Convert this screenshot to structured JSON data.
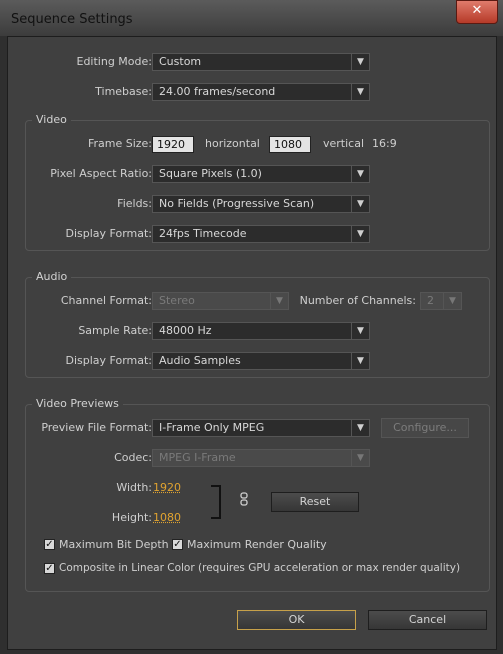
{
  "window": {
    "title": "Sequence Settings",
    "close_glyph": "✕"
  },
  "general": {
    "editing_mode_label": "Editing Mode:",
    "editing_mode_value": "Custom",
    "timebase_label": "Timebase:",
    "timebase_value": "24.00 frames/second"
  },
  "video": {
    "group_title": "Video",
    "frame_size_label": "Frame Size:",
    "frame_width": "1920",
    "horizontal_label": "horizontal",
    "frame_height": "1080",
    "vertical_label": "vertical",
    "aspect": "16:9",
    "par_label": "Pixel Aspect Ratio:",
    "par_value": "Square Pixels (1.0)",
    "fields_label": "Fields:",
    "fields_value": "No Fields (Progressive Scan)",
    "display_format_label": "Display Format:",
    "display_format_value": "24fps Timecode"
  },
  "audio": {
    "group_title": "Audio",
    "channel_format_label": "Channel Format:",
    "channel_format_value": "Stereo",
    "num_channels_label": "Number of Channels:",
    "num_channels_value": "2",
    "sample_rate_label": "Sample Rate:",
    "sample_rate_value": "48000 Hz",
    "display_format_label": "Display Format:",
    "display_format_value": "Audio Samples"
  },
  "previews": {
    "group_title": "Video Previews",
    "file_format_label": "Preview File Format:",
    "file_format_value": "I-Frame Only MPEG",
    "configure_label": "Configure...",
    "codec_label": "Codec:",
    "codec_value": "MPEG I-Frame",
    "width_label": "Width:",
    "width_value": "1920",
    "height_label": "Height:",
    "height_value": "1080",
    "reset_label": "Reset",
    "link_icon": "link-icon"
  },
  "options": {
    "max_bit_depth": "Maximum Bit Depth",
    "max_render_quality": "Maximum Render Quality",
    "composite_linear": "Composite in Linear Color (requires GPU acceleration or max render quality)",
    "check_glyph": "✓"
  },
  "buttons": {
    "ok": "OK",
    "cancel": "Cancel"
  },
  "colors": {
    "accent": "#e0a330",
    "ok_border": "#c7a14a",
    "close": "#c4473a"
  }
}
